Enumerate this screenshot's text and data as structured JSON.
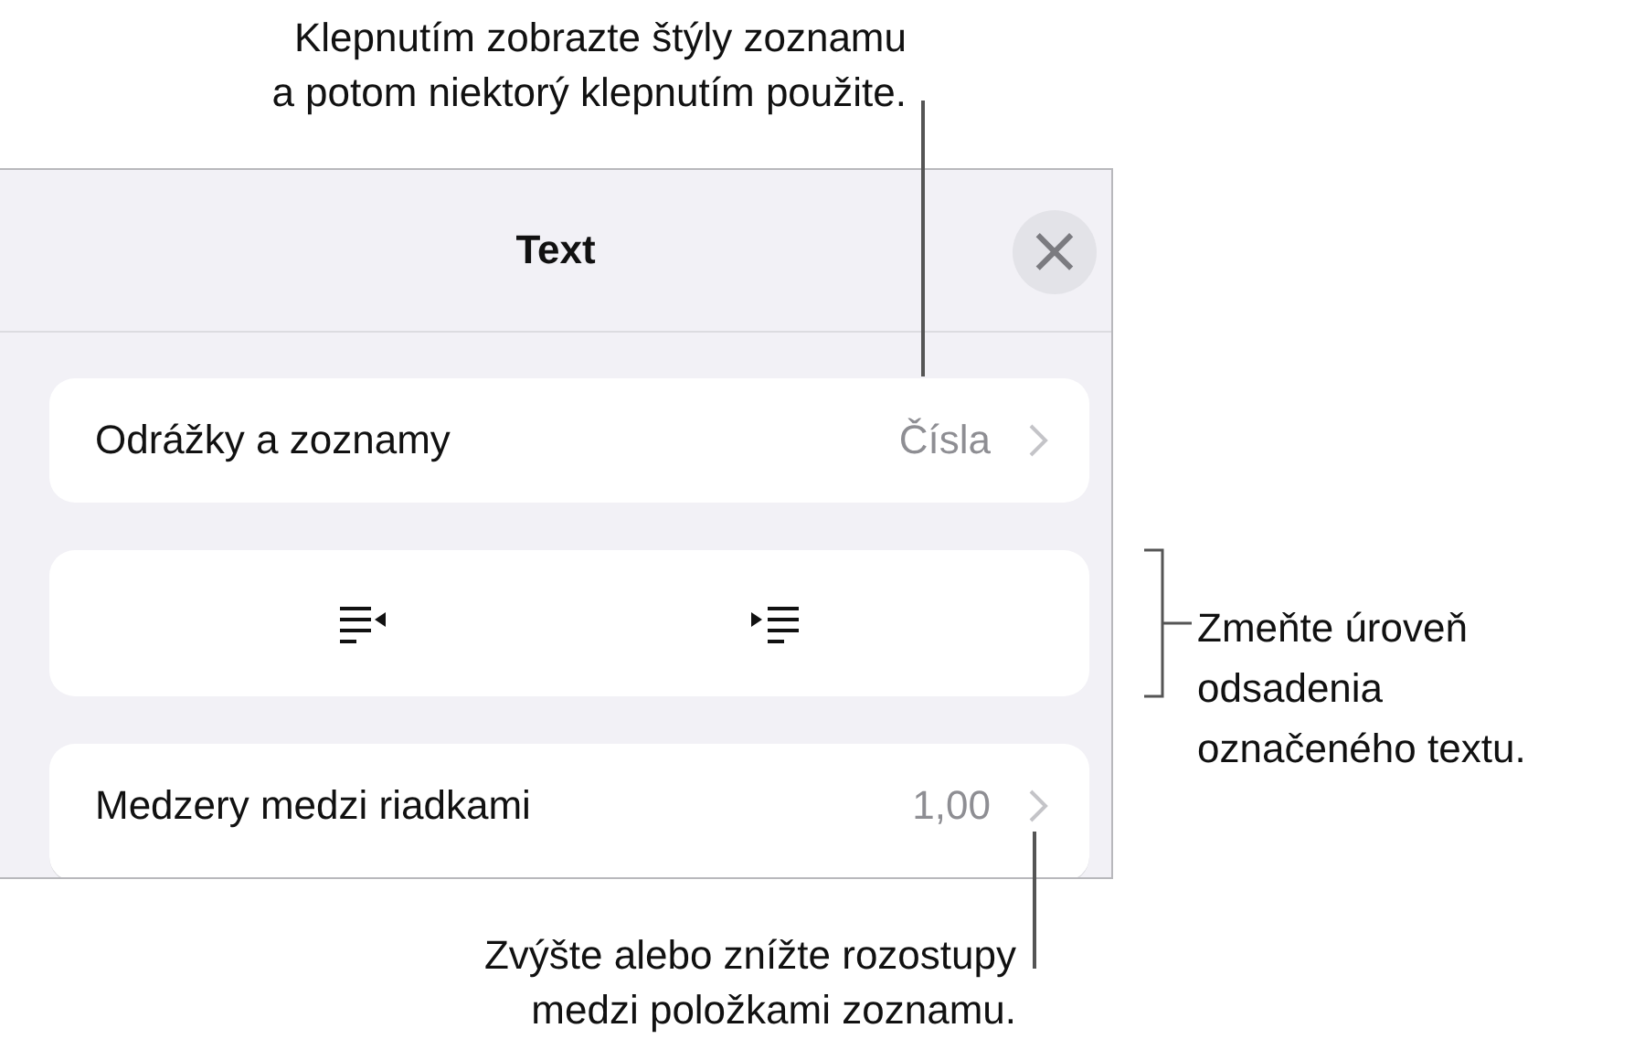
{
  "panel": {
    "title": "Text",
    "close": "×",
    "rows": [
      {
        "kind": "disclosure",
        "label": "Odrážky a zoznamy",
        "value": "Čísla"
      },
      {
        "kind": "indent-buttons"
      },
      {
        "kind": "disclosure",
        "label": "Medzery medzi riadkami",
        "value": "1,00"
      }
    ]
  },
  "callouts": [
    {
      "kind": "top",
      "text": "Klepnutím zobrazte štýly zoznamu\na potom niektorý klepnutím použite."
    },
    {
      "kind": "bracket",
      "text": "Zmeňte úroveň\nodsadenia\noznačeného textu."
    },
    {
      "kind": "bottom",
      "text": "Zvýšte alebo znížte rozostupy\nmedzi položkami zoznamu."
    }
  ]
}
